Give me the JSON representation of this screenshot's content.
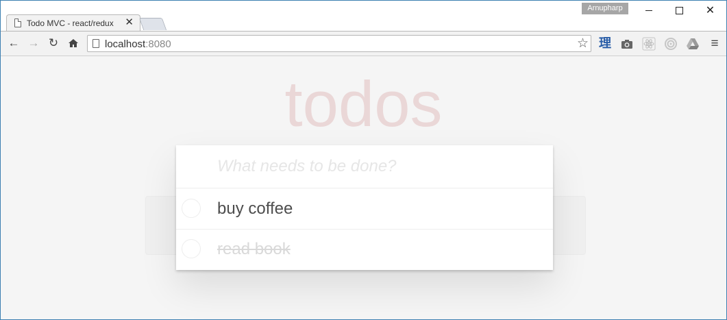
{
  "browser": {
    "tab": {
      "title": "Todo MVC - react/redux",
      "close": "✕"
    },
    "profile": "Arnupharp",
    "window_controls": {
      "close": "✕"
    },
    "toolbar": {
      "back": "←",
      "forward": "→",
      "reload": "↻",
      "home": "⌂",
      "url_host": "localhost",
      "url_port": ":8080",
      "star": "☆",
      "extensions": [
        "理",
        "camera-icon",
        "react-devtools-icon",
        "target-icon",
        "drive-icon"
      ],
      "menu": "≡"
    }
  },
  "app": {
    "heading": "todos",
    "new_todo_placeholder": "What needs to be done?",
    "todos": [
      {
        "text": "buy coffee",
        "completed": false
      },
      {
        "text": "read book",
        "completed": true
      }
    ]
  },
  "colors": {
    "heading": "#ead7d7",
    "background": "#f5f5f5",
    "text": "#4d4d4d",
    "completed_text": "#d9d9d9",
    "extension_li": "#2a5ea8"
  }
}
